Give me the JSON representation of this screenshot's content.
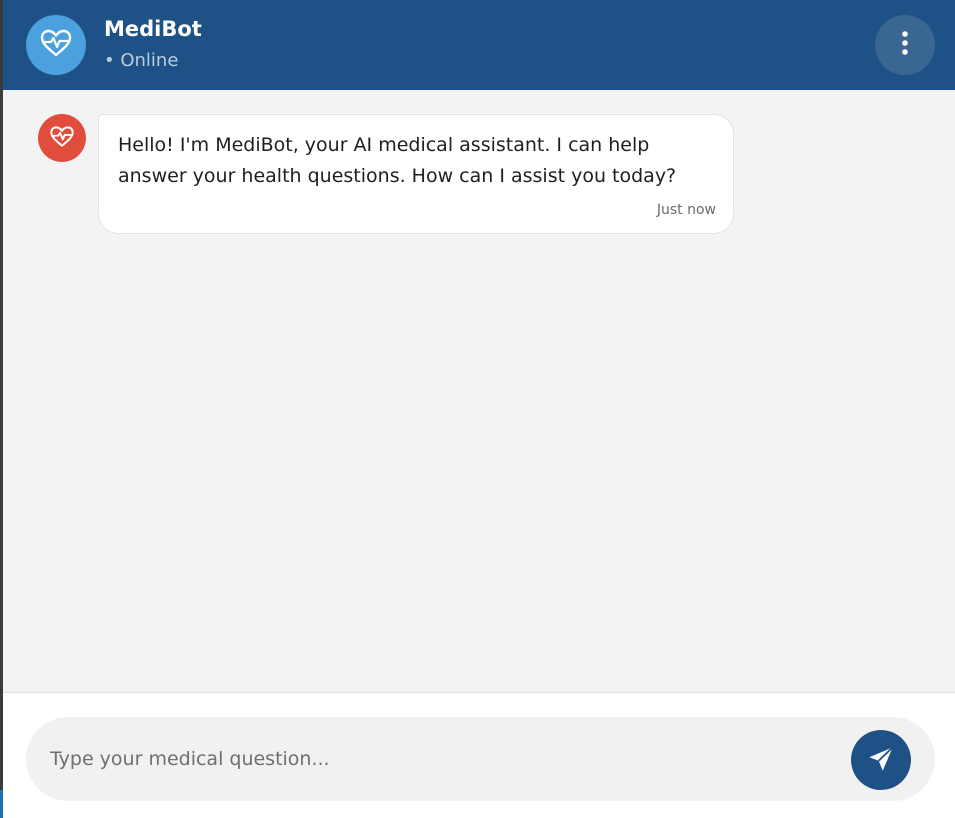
{
  "header": {
    "title": "MediBot",
    "status": "• Online",
    "avatar_icon": "heartbeat-icon",
    "menu_icon": "more-vertical-icon"
  },
  "messages": [
    {
      "sender": "bot",
      "avatar_icon": "heartbeat-icon",
      "text": "Hello! I'm MediBot, your AI medical assistant. I can help answer your health questions. How can I assist you today?",
      "time": "Just now"
    }
  ],
  "composer": {
    "placeholder": "Type your medical question...",
    "value": "",
    "send_icon": "send-icon"
  },
  "colors": {
    "header_bg": "#1e5186",
    "header_avatar": "#4aa1de",
    "bot_avatar": "#e14d3d",
    "chat_bg": "#f3f3f3",
    "send_button": "#1e5186"
  }
}
